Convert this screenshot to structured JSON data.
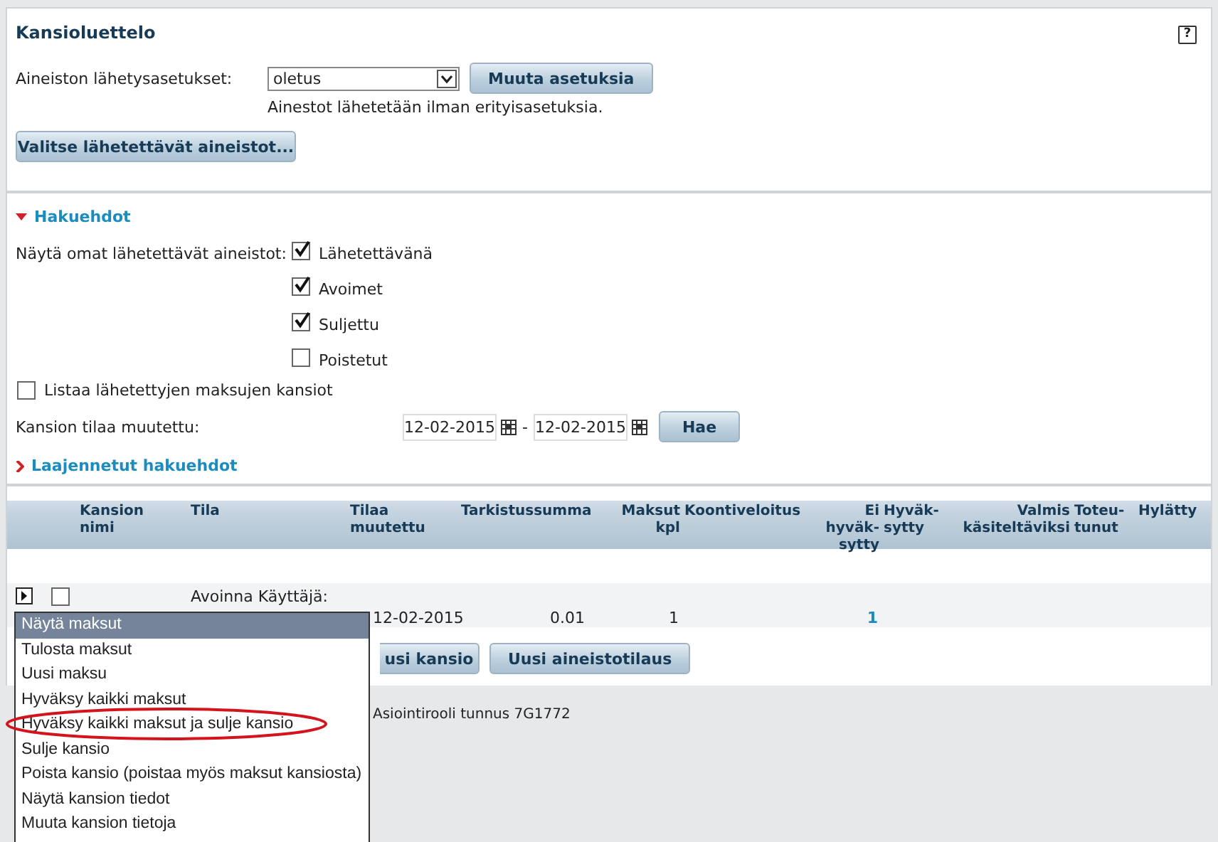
{
  "title": "Kansioluettelo",
  "help": "?",
  "settings": {
    "label": "Aineiston lähetysasetukset:",
    "value": "oletus",
    "button": "Muuta asetuksia",
    "hint": "Ainestot lähetetään ilman erityisasetuksia."
  },
  "select_button": "Valitse lähetettävät aineistot...",
  "search": {
    "label": "Hakuehdot",
    "expanded": true,
    "show_label": "Näytä omat lähetettävät aineistot:",
    "options": [
      {
        "label": "Lähetettävänä",
        "checked": true
      },
      {
        "label": "Avoimet",
        "checked": true
      },
      {
        "label": "Suljettu",
        "checked": true
      },
      {
        "label": "Poistetut",
        "checked": false
      }
    ],
    "list_sent": {
      "label": "Listaa lähetettyjen maksujen kansiot",
      "checked": false
    },
    "date_label": "Kansion tilaa muutettu:",
    "date_from": "12-02-2015",
    "date_separator": "-",
    "date_to": "12-02-2015",
    "button": "Hae"
  },
  "extended": {
    "label": "Laajennetut hakuehdot",
    "expanded": false
  },
  "table": {
    "columns": [
      "Kansion nimi",
      "Tila",
      "Tilaa muutettu",
      "Tarkistussumma",
      "Maksut kpl",
      "Koontiveloitus",
      "Ei hyväk-sytty",
      "Hyväk-sytty",
      "Valmis käsiteltäviksi",
      "Toteu-tunut",
      "Hylätty"
    ],
    "rows": [
      {
        "expanded": false,
        "checked": false,
        "status": "Avoinna Käyttäjä:",
        "changed": "12-02-2015",
        "checksum": "0.01",
        "count": "1",
        "not_approved": "1"
      }
    ]
  },
  "buttons": [
    "usi kansio",
    "Uusi aineistotilaus"
  ],
  "status_text": "Asiointirooli tunnus 7G1772",
  "context_menu": [
    {
      "label": "Näytä maksut",
      "selected": true,
      "circled": false
    },
    {
      "label": "Tulosta maksut",
      "selected": false,
      "circled": false
    },
    {
      "label": "Uusi maksu",
      "selected": false,
      "circled": false
    },
    {
      "label": "Hyväksy kaikki maksut",
      "selected": false,
      "circled": false
    },
    {
      "label": "Hyväksy kaikki maksut ja sulje kansio",
      "selected": false,
      "circled": true
    },
    {
      "label": "Sulje kansio",
      "selected": false,
      "circled": false
    },
    {
      "label": "Poista kansio (poistaa myös maksut kansiosta)",
      "selected": false,
      "circled": false
    },
    {
      "label": "Näytä kansion tiedot",
      "selected": false,
      "circled": false
    },
    {
      "label": "Muuta kansion tietoja",
      "selected": false,
      "circled": false
    }
  ]
}
